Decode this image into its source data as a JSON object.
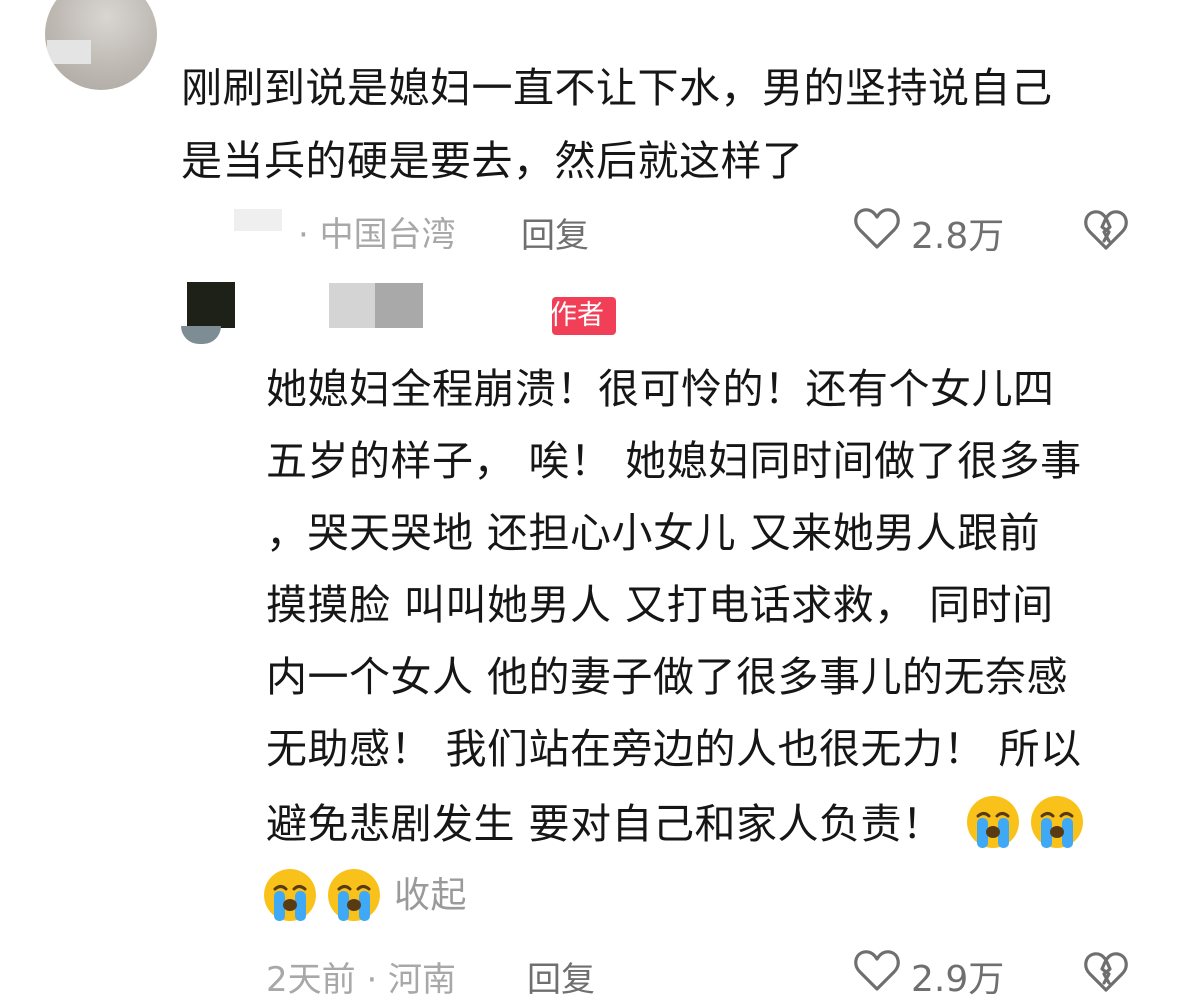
{
  "comment": {
    "text_lines": [
      "刚刷到说是媳妇一直不让下水，男的坚持说自己",
      "是当兵的硬是要去，然后就这样了"
    ],
    "location": "· 中国台湾",
    "reply_label": "回复",
    "like_count": "2.8万"
  },
  "reply": {
    "author_badge": "作者",
    "text_lines": [
      "她媳妇全程崩溃！很可怜的！还有个女儿四",
      "五岁的样子， 唉！ 她媳妇同时间做了很多事",
      "，哭天哭地 还担心小女儿 又来她男人跟前",
      "摸摸脸 叫叫她男人 又打电话求救， 同时间",
      "内一个女人 他的妻子做了很多事儿的无奈感",
      "无助感！ 我们站在旁边的人也很无力！ 所以",
      "避免悲剧发生 要对自己和家人负责！"
    ],
    "collapse_label": "收起",
    "time_location": "2天前 · 河南",
    "reply_label": "回复",
    "like_count": "2.9万"
  },
  "colors": {
    "badge": "#f13f58",
    "meta_text": "#a8a8a8",
    "action_text": "#6f6f6f"
  },
  "icons": [
    "heart-outline-icon",
    "broken-heart-icon",
    "loudly-crying-face-emoji"
  ]
}
